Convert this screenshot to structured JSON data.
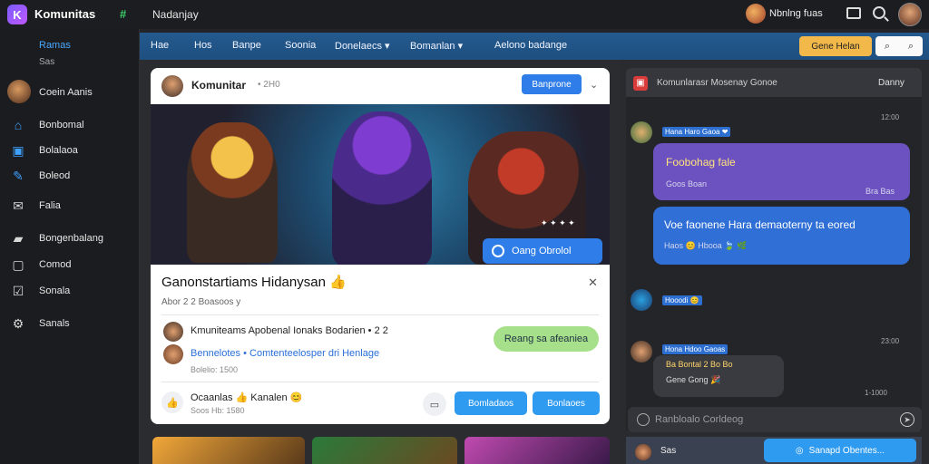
{
  "app": {
    "name": "Komunitas",
    "logo_letter": "K",
    "badge": "#",
    "top_title": "Nadanjay",
    "user_name": "Nbnlng fuas"
  },
  "sidebar": {
    "header": "Ramas",
    "sub": "Sas",
    "profile_label": "Coein Aanis",
    "items": [
      {
        "label": "Bonbomal",
        "icon": "home-icon"
      },
      {
        "label": "Bolalaoa",
        "icon": "groups-icon"
      },
      {
        "label": "Boleod",
        "icon": "edit-icon"
      },
      {
        "label": "Falia",
        "icon": "mail-icon"
      },
      {
        "label": "Bongenbalang",
        "icon": "folder-icon"
      },
      {
        "label": "Comod",
        "icon": "chat-icon"
      },
      {
        "label": "Sonala",
        "icon": "checklist-icon"
      },
      {
        "label": "Sanals",
        "icon": "settings-icon"
      }
    ]
  },
  "nav": {
    "items": [
      "Hae",
      "Hos",
      "Banpe",
      "Soonia",
      "Donelaecs",
      "Bomanlan",
      "Aelono badange"
    ],
    "cta_label": "Gene Helan",
    "cta2_a": "⌕",
    "cta2_b": "⌕"
  },
  "post": {
    "author": "Komunitar",
    "time": "• 2H0",
    "follow_label": "Banprone",
    "hero_pill": "Oang Obrolol",
    "hero_sparks": "✦ ✦ ✦ ✦",
    "title": "Ganonstartiams Hidanysan 👍",
    "meta": "Abor 2 2 Boasoos y",
    "comments": [
      {
        "text": "Kmuniteams Apobenal Ionaks Bodarien • 2 2",
        "sub": ""
      },
      {
        "text": "Bennelotes • Comtenteelosper dri Henlage",
        "sub": "Bolelio: 1500"
      }
    ],
    "green_bubble": "Reang sa afeaniea",
    "footer_text": "Ocaanlas 👍 Kanalen 😊",
    "footer_sub": "Soos Hb: 1580",
    "btn1": "Bomladaos",
    "btn2": "Bonlaoes"
  },
  "chat": {
    "title": "Komunlarasr Mosenay Gonoe",
    "right_label": "Danny",
    "messages": [
      {
        "name": "Hana Haro Gaoa ❤",
        "time": "12:00",
        "text": "Foobohag fale",
        "sub": "Goos Boan",
        "stamp": "Bra Bas"
      },
      {
        "name": "",
        "time": "",
        "text": "Voe faonene Hara demaoterny ta eored",
        "sub": "Haos 😊 Hbooa 🍃 🌿",
        "stamp": ""
      },
      {
        "name": "Hooodi 😊",
        "time": "",
        "text": "",
        "sub": "",
        "stamp": ""
      },
      {
        "name": "Hona Hdoo Gaoas",
        "time": "23:00",
        "text": "Ba Bontal 2 Bo Bo",
        "sub": "Gene Gong 🎉",
        "stamp": "1-1000"
      }
    ],
    "input_placeholder": "Ranbloalo Corldeog",
    "footer_label": "Sas",
    "footer_pill": "Sanapd Obentes..."
  },
  "colors": {
    "accent": "#2f7de8",
    "nav": "#245a8e",
    "bg": "#232427",
    "bubble_purple": "#6c52c0",
    "bubble_blue": "#2f6fd6",
    "green": "#a6e08a",
    "yellow": "#f2b84a"
  }
}
